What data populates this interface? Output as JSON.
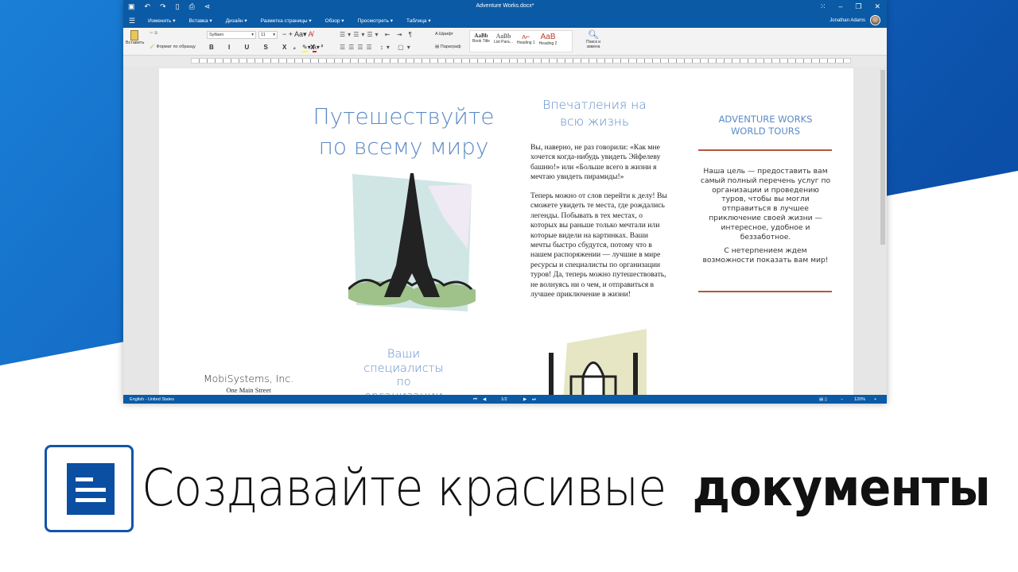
{
  "app": {
    "quick_access": [
      "save-icon",
      "undo-icon",
      "redo-icon",
      "new-icon",
      "print-icon",
      "share-icon"
    ],
    "title": "Adventure Works.docx*",
    "user": "Jonathan Adams"
  },
  "menu": [
    "Изменить ▾",
    "Вставка ▾",
    "Дизайн ▾",
    "Разметка страницы ▾",
    "Обзор ▾",
    "Просмотреть ▾",
    "Таблица ▾"
  ],
  "ribbon": {
    "paste": "Вставить",
    "format_painter": "Формат по образцу",
    "font_name": "Sylfaen",
    "font_size": "11",
    "font_dialog": "Шрифт",
    "paragraph_dialog": "Параграф",
    "styles": [
      "Book Title",
      "List Para...",
      "Heading 1",
      "Heading 2"
    ],
    "find_replace": "Поиск и замена"
  },
  "status": {
    "language": "English - United States",
    "page": "1/2",
    "zoom": "120%"
  },
  "doc": {
    "col1_title": "Путешествуйте по всему миру",
    "col1_sub": "Ваши специалисты по организации",
    "company": "MobiSystems, Inc.",
    "address": "One Main Street",
    "col2_title": "Впечатления на всю жизнь",
    "col2_p1": "Вы, наверно, не раз говорили: «Как мне хочется когда-нибудь увидеть Эйфелеву башню!» или «Больше всего в жизни я мечтаю увидеть пирамиды!»",
    "col2_p2": "Теперь можно от слов перейти к делу! Вы сможете увидеть те места, где рождались легенды. Побывать в тех местах, о которых вы раньше только мечтали или которые видели на картинках. Ваши мечты быстро сбудутся, потому что в нашем распоряжении — лучшие в мире ресурсы и специалисты по организации туров! Да, теперь можно путешествовать, не волнуясь ни о чем, и отправиться в лучшее приключение в жизни!",
    "col3_title": "ADVENTURE WORKS WORLD TOURS",
    "col3_p1": "Наша цель — предоставить вам самый полный перечень услуг по организации и проведению туров, чтобы вы могли отправиться в лучшее приключение своей жизни — интересное, удобное и беззаботное.",
    "col3_p2": "С нетерпением ждем возможности показать вам мир!"
  },
  "banner": {
    "text_light": "Создавайте красивые",
    "text_bold": "документы"
  },
  "colors": {
    "brand": "#0b5aa5",
    "heading": "#5b8ac6",
    "rule": "#b4573a"
  }
}
